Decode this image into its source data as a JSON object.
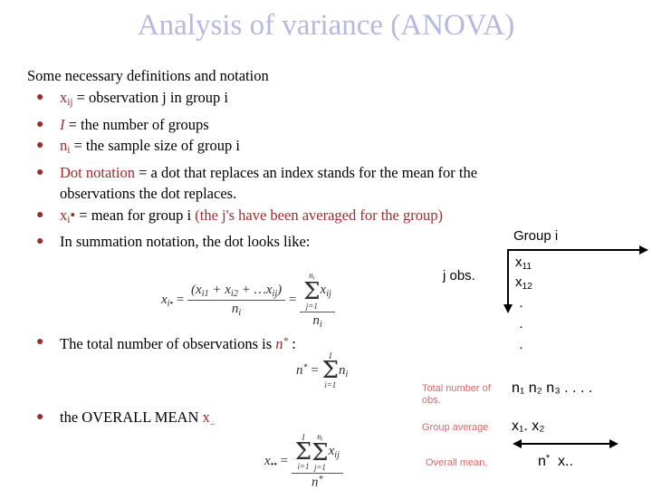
{
  "slide": {
    "title": "Analysis of variance (ANOVA)",
    "title_color": "#b5b9e0",
    "accent_red": "#9e2b2b",
    "legend_red": "#e06666",
    "lead_line": "Some necessary definitions and notation"
  },
  "bullets": {
    "b1": {
      "symbol": "x",
      "sub": "ij",
      "text": " = observation j in group i"
    },
    "b2": {
      "symbol": "I",
      "text": " = the number of groups"
    },
    "b3": {
      "symbol": "n",
      "sub": "i",
      "text": " = the sample size of group i"
    },
    "b4": {
      "symbol": "Dot notation",
      "text": " = a dot that replaces an index stands for the mean for the",
      "text_line2": "observations the dot replaces."
    },
    "b5": {
      "symbol": "x",
      "sub": "i",
      "dot": "•",
      "text": " = mean for group i ",
      "red_tail": "(the j's have been averaged for the group)"
    },
    "b6": {
      "text": "In summation notation, the dot looks like:"
    },
    "b7": {
      "text_before": "The total number of observations is ",
      "symbol": "n",
      "star": "*",
      "text_after": " :"
    },
    "b8": {
      "text_before": "the OVERALL MEAN ",
      "symbol": "x",
      "dots": ".."
    }
  },
  "equations": {
    "group_mean": {
      "lhs_var": "x",
      "lhs_sub": "i•",
      "eq1": "=",
      "numerator": "(x",
      "num_s1": "i1",
      "num_plus1": " + x",
      "num_s2": "i2",
      "num_plus2": " + …x",
      "num_s3": "ij",
      "num_close": ")",
      "denominator": "n",
      "den_sub": "i",
      "eq2": "=",
      "sum_upper": "n",
      "sum_upper_sub": "i",
      "sum_sigma": "Σ",
      "sum_lower": "j=1",
      "sum_body": "x",
      "sum_body_sub": "ij",
      "denominator2": "n",
      "den2_sub": "i"
    },
    "total_n": {
      "lhs": "n",
      "lhs_star": "*",
      "eq": "=",
      "sum_upper": "I",
      "sum_sigma": "Σ",
      "sum_lower": "i=1",
      "sum_body": "n",
      "sum_body_sub": "i"
    },
    "overall_mean": {
      "lhs": "x",
      "lhs_dots": "••",
      "eq": "=",
      "sum1_upper": "I",
      "sum1_sigma": "Σ",
      "sum1_lower": "i=1",
      "sum2_upper": "n",
      "sum2_upper_sub": "i",
      "sum2_sigma": "Σ",
      "sum2_lower": "j=1",
      "sum_body": "x",
      "sum_body_sub": "ij",
      "denominator": "n",
      "den_star": "*"
    }
  },
  "schematic": {
    "group_axis_label": "Group i",
    "obs_axis_label": "j obs.",
    "cells": [
      {
        "var": "x",
        "sub": "11"
      },
      {
        "var": "x",
        "sub": "12"
      }
    ],
    "vertical_dots": [
      "·",
      "·",
      "·"
    ]
  },
  "legend": {
    "rows": [
      {
        "label": "Total number of\nobs.",
        "value": "n₁  n₂  n₃ . . . ."
      },
      {
        "label": "Group average",
        "value": "x₁. x₂"
      },
      {
        "label": "Overall mean,",
        "value_n": "n",
        "value_star": "*",
        "value_x": "x.."
      }
    ]
  }
}
